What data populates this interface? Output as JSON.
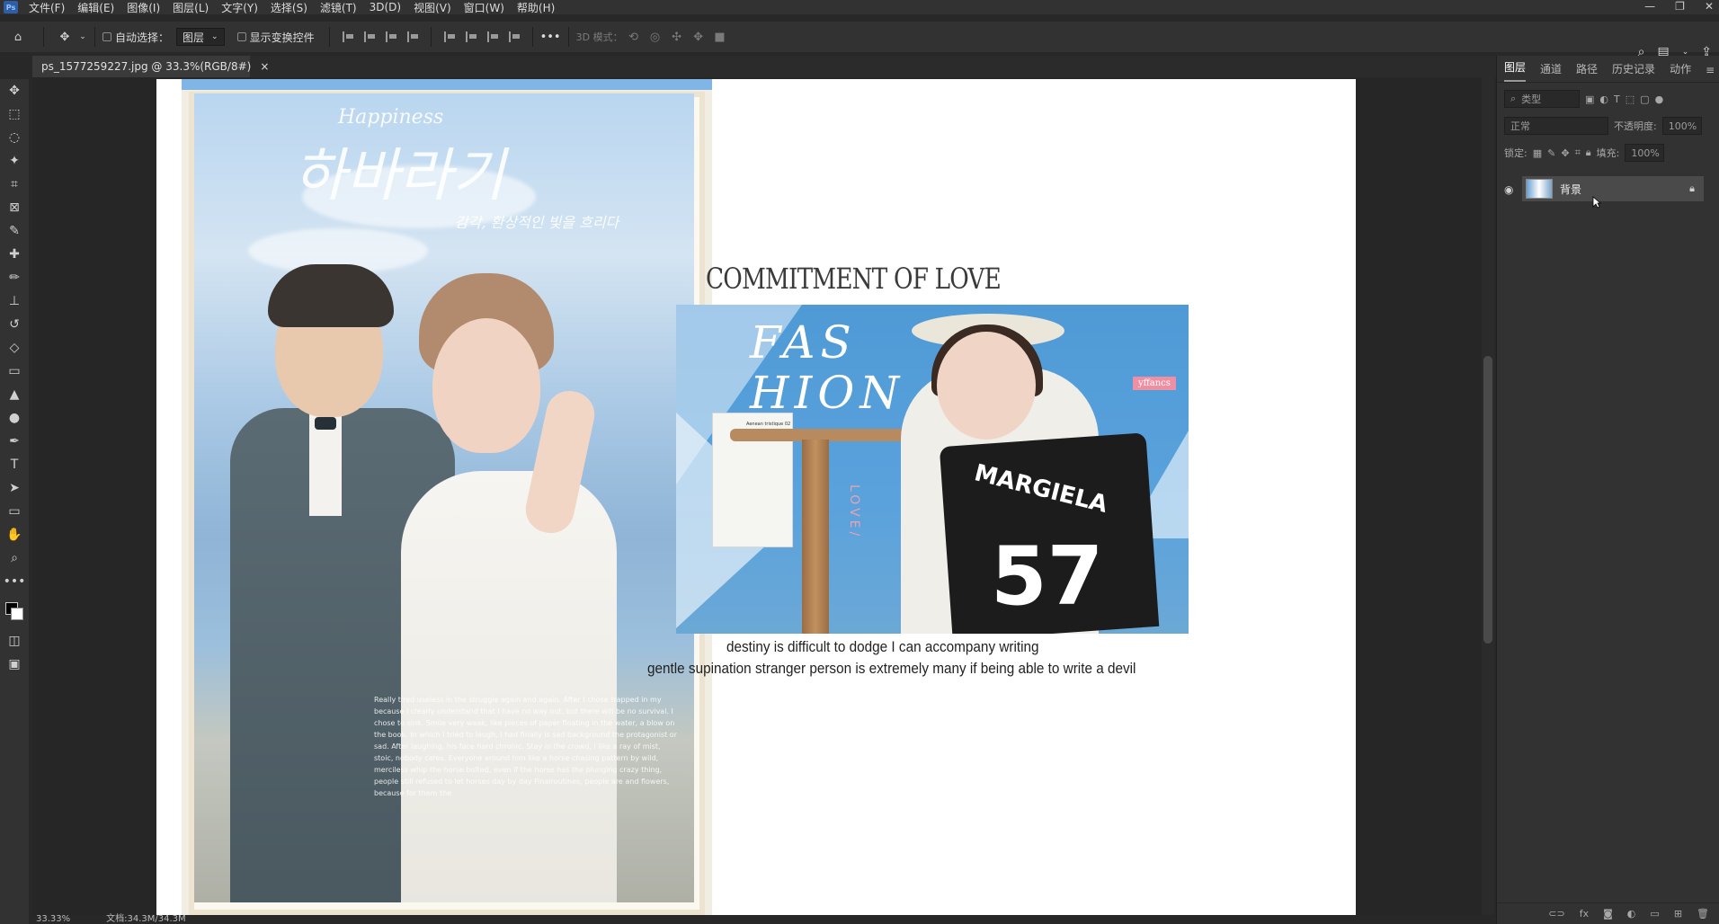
{
  "app": {
    "logo": "Ps",
    "menu": [
      "文件(F)",
      "编辑(E)",
      "图像(I)",
      "图层(L)",
      "文字(Y)",
      "选择(S)",
      "滤镜(T)",
      "3D(D)",
      "视图(V)",
      "窗口(W)",
      "帮助(H)"
    ],
    "window_controls": [
      "—",
      "❐",
      "✕"
    ]
  },
  "options": {
    "auto_select_label": "自动选择：",
    "auto_select_value": "图层",
    "show_transform_label": "显示变换控件",
    "mode_3d_label": "3D 模式：",
    "more": "•••"
  },
  "document": {
    "tab_label": "ps_1577259227.jpg @ 33.3%(RGB/8#)",
    "close": "×"
  },
  "canvas": {
    "headline": "COMMITMENT OF LOVE",
    "body_line_1": "destiny is difficult to dodge I  can accompany writing",
    "body_line_2": "gentle supination stranger person is extremely many  if being able to write a devil",
    "left_photo": {
      "hap_text": "Happiness",
      "korean_title": "하바라기",
      "korean_sub": "감각, 환상적인 빛을 흐리다",
      "caption": "Really tired useless in the struggle again and again. After I chose trapped in my because I clearly understand that I have no way out, but there will be no survival. I chose to sink. Smile very weak, like pieces of paper floating in the water, a blow on the book. In which I tried to laugh, I had finally is sad background the protagonist or sad. After laughing, his face hard chronic. Stay in the crowd, I like a ray of mist, stoic, nobody cares. Everyone around him like a horse chasing pattern by wild, merciless whip the horse bolted, even if the horse has the plunging crazy thing, people still refused to let horses day by day Finalroutines, people are and flowers, because for them the"
    },
    "fashion_photo": {
      "title": "FAS HION",
      "vertical": "LOVE/",
      "tag": "yffancs",
      "bag_text": "MARGIELA",
      "bag_num": "57",
      "mag_text": "Aenean tristique 02"
    }
  },
  "status": {
    "zoom": "33.33%",
    "doc_size": "文档:34.3M/34.3M"
  },
  "panel": {
    "tabs": [
      "图层",
      "通道",
      "路径",
      "历史记录",
      "动作"
    ],
    "filter_placeholder": "类型",
    "blend_mode": "正常",
    "opacity_label": "不透明度:",
    "opacity_value": "100%",
    "lock_label": "锁定:",
    "fill_label": "填充:",
    "fill_value": "100%",
    "layer_name": "背景"
  },
  "colors": {
    "ui_bg": "#323232",
    "canvas_bg": "#262626",
    "photo_sky": "#8fb4d6",
    "fashion_blue": "#4f9ad6",
    "accent_pink": "#ef8fa4"
  }
}
